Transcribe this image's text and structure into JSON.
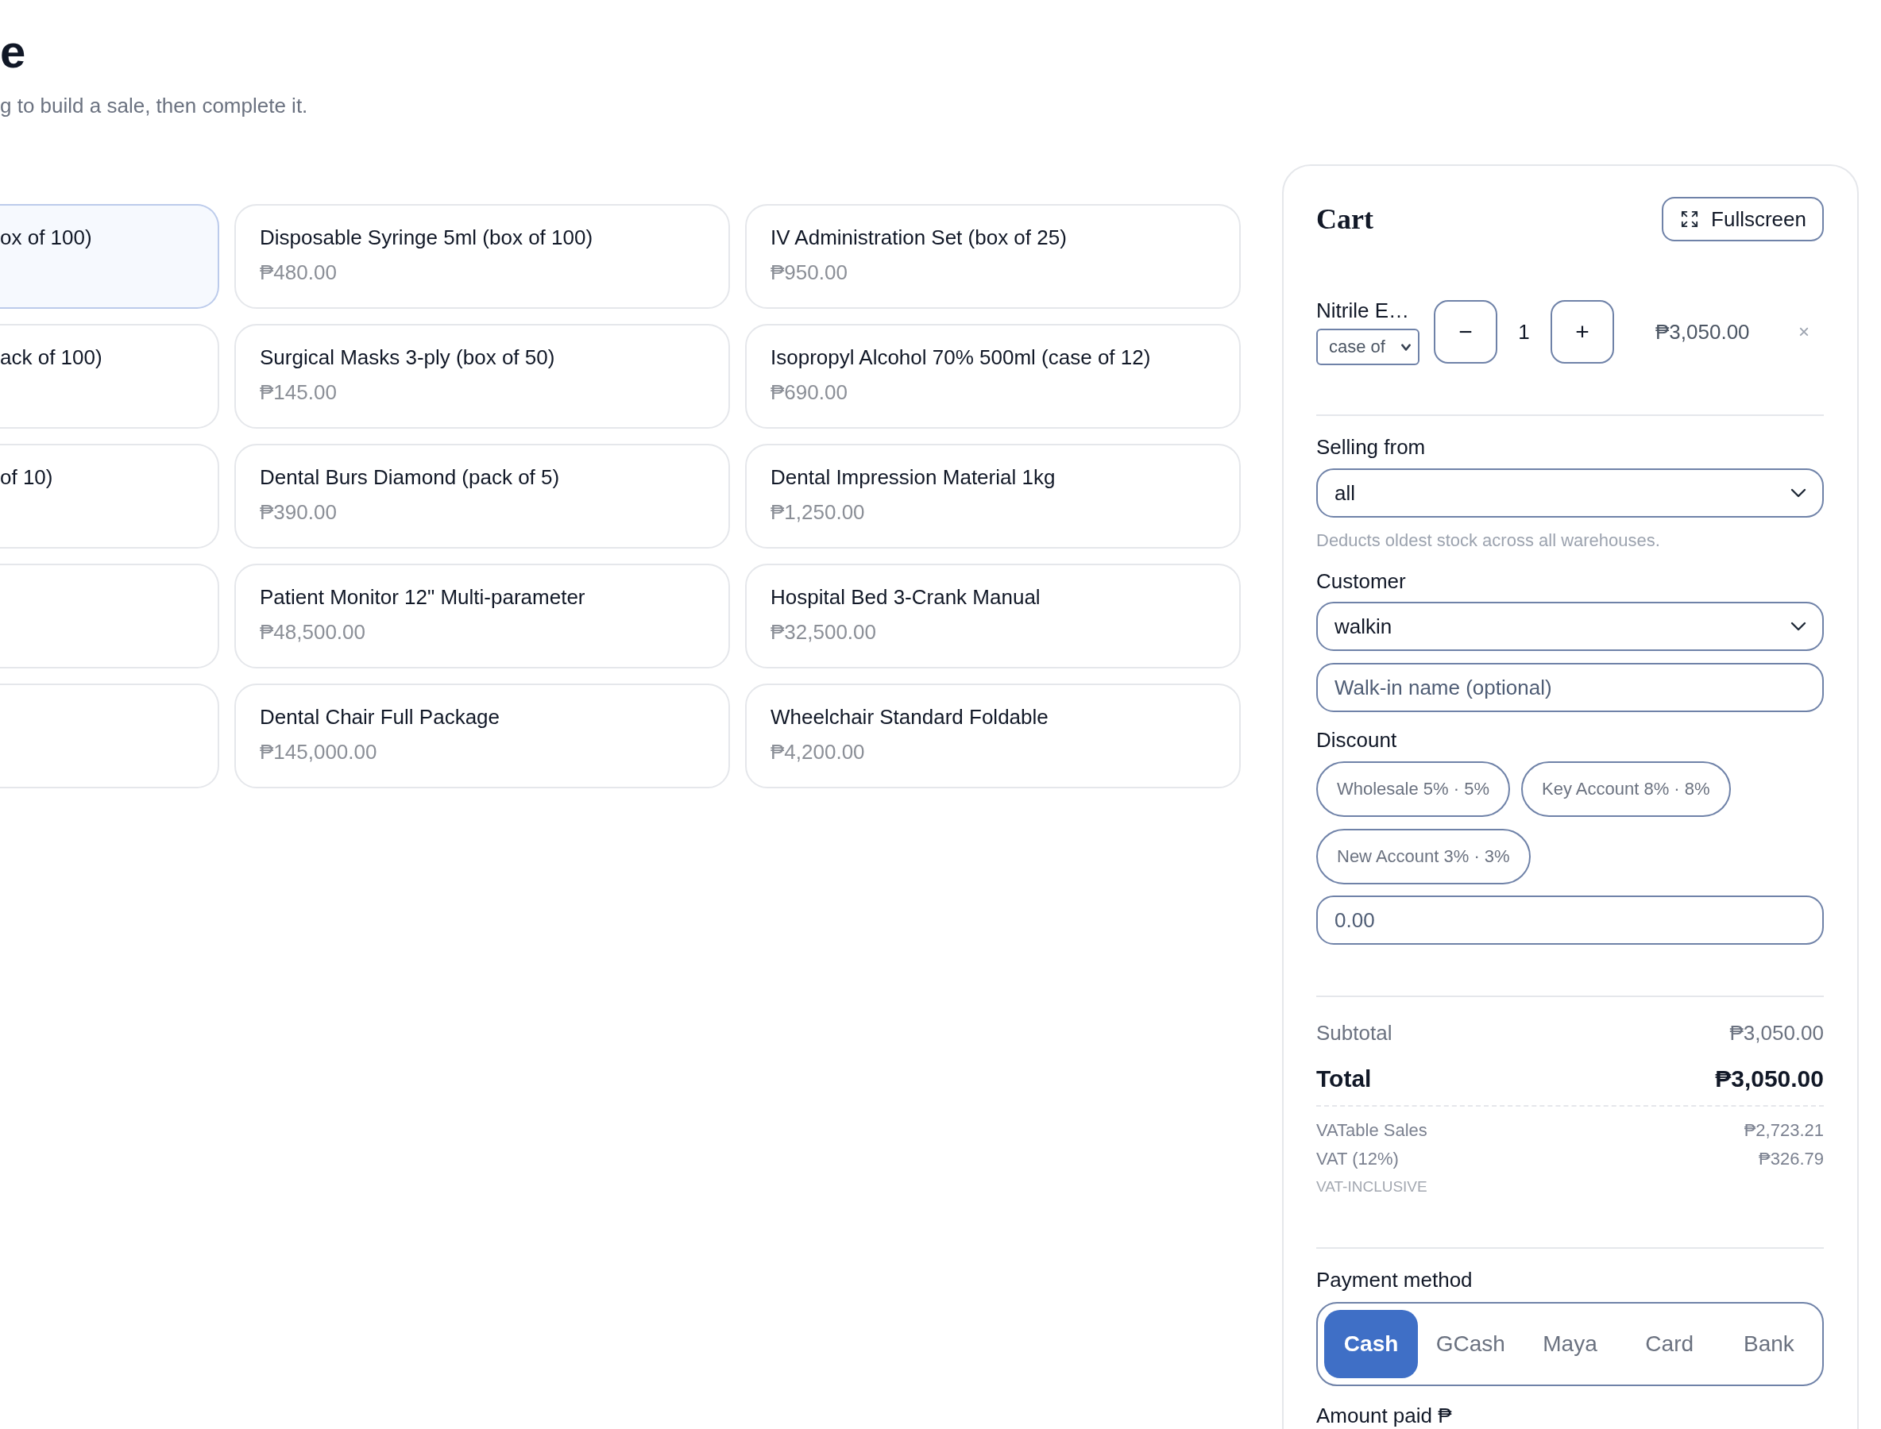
{
  "page": {
    "title": "e",
    "subtitle": "g to build a sale, then complete it."
  },
  "products": [
    {
      "name": "ox of 100)",
      "selected": true
    },
    {
      "name": "Disposable Syringe 5ml (box of 100)",
      "price": "₱480.00",
      "selected": false
    },
    {
      "name": "IV Administration Set (box of 25)",
      "price": "₱950.00",
      "selected": false
    },
    {
      "name": "ack of 100)",
      "selected": false
    },
    {
      "name": "Surgical Masks 3-ply (box of 50)",
      "price": "₱145.00",
      "selected": false
    },
    {
      "name": "Isopropyl Alcohol 70% 500ml (case of 12)",
      "price": "₱690.00",
      "selected": false
    },
    {
      "name": "of 10)",
      "selected": false
    },
    {
      "name": "Dental Burs Diamond (pack of 5)",
      "price": "₱390.00",
      "selected": false
    },
    {
      "name": "Dental Impression Material 1kg",
      "price": "₱1,250.00",
      "selected": false
    },
    {
      "selected": false
    },
    {
      "name": "Patient Monitor 12\" Multi-parameter",
      "price": "₱48,500.00",
      "selected": false
    },
    {
      "name": "Hospital Bed 3-Crank Manual",
      "price": "₱32,500.00",
      "selected": false
    },
    {
      "selected": false
    },
    {
      "name": "Dental Chair Full Package",
      "price": "₱145,000.00",
      "selected": false
    },
    {
      "name": "Wheelchair Standard Foldable",
      "price": "₱4,200.00",
      "selected": false
    }
  ],
  "cart": {
    "title": "Cart",
    "fullscreen_button": "Fullscreen",
    "items": [
      {
        "name": "Nitrile E…",
        "unit": "case of",
        "decrease": "−",
        "quantity": "1",
        "increase": "+",
        "line_total": "₱3,050.00",
        "remove": "×"
      }
    ],
    "selling_from": {
      "label": "Selling from",
      "value": "all",
      "hint": "Deducts oldest stock across all warehouses."
    },
    "customer": {
      "label": "Customer",
      "value": "walkin",
      "name_field": {
        "placeholder": "Walk-in name (optional)"
      }
    },
    "discount": {
      "label": "Discount",
      "presets": [
        {
          "label": "Wholesale 5% · 5%",
          "selected": false
        },
        {
          "label": "Key Account 8% · 8%",
          "selected": false
        },
        {
          "label": "New Account 3% · 3%",
          "selected": false
        }
      ],
      "field": {
        "placeholder": "0.00"
      }
    },
    "totals": {
      "subtotal": {
        "label": "Subtotal",
        "value": "₱3,050.00"
      },
      "total": {
        "label": "Total",
        "value": "₱3,050.00"
      },
      "vat_breakdown": [
        {
          "label": "VATable Sales",
          "value": "₱2,723.21"
        },
        {
          "label": "VAT (12%)",
          "value": "₱326.79"
        }
      ],
      "note": "VAT-INCLUSIVE"
    },
    "payment": {
      "label": "Payment method",
      "methods": [
        {
          "label": "Cash",
          "selected": true
        },
        {
          "label": "GCash",
          "selected": false
        },
        {
          "label": "Maya",
          "selected": false
        },
        {
          "label": "Card",
          "selected": false
        },
        {
          "label": "Bank",
          "selected": false
        }
      ]
    },
    "amount_paid": {
      "label": "Amount paid ₱"
    }
  }
}
